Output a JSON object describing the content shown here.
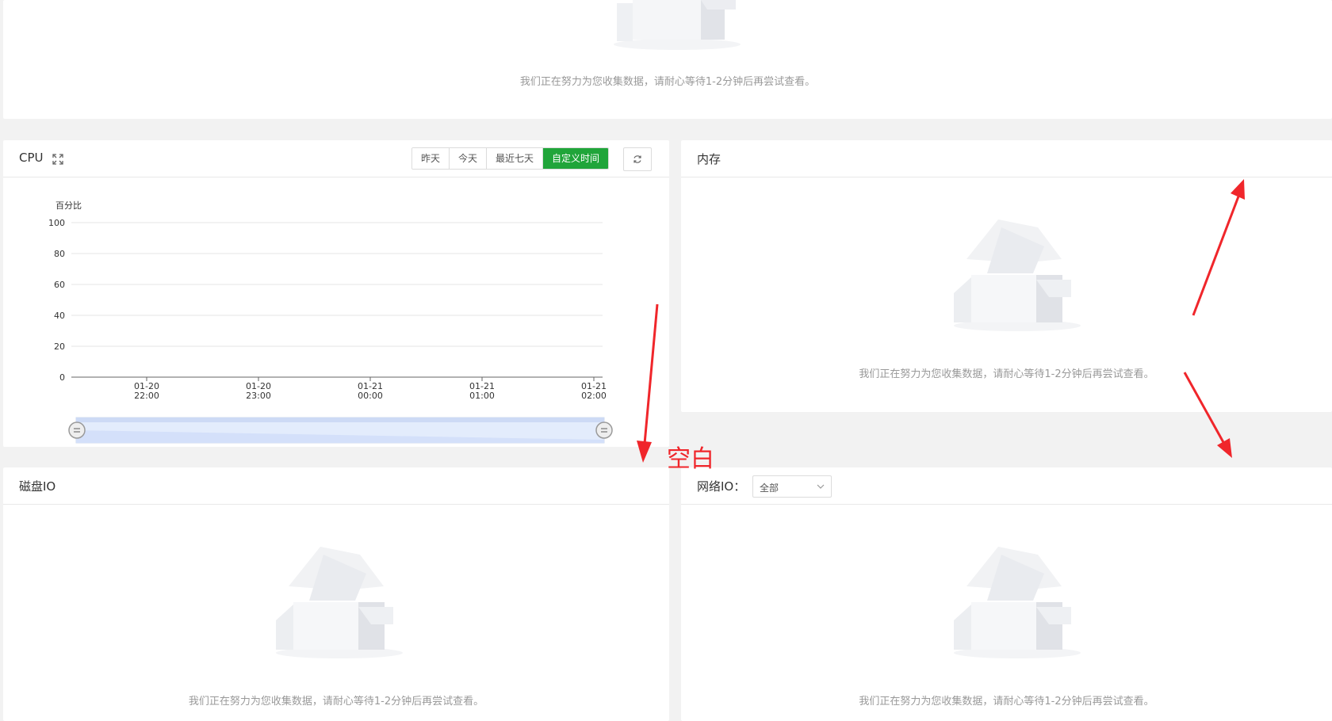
{
  "top_panel": {
    "empty_text": "我们正在努力为您收集数据，请耐心等待1-2分钟后再尝试查看。"
  },
  "cpu_panel": {
    "title": "CPU",
    "range_buttons": [
      "昨天",
      "今天",
      "最近七天",
      "自定义时间"
    ],
    "active_range": "自定义时间"
  },
  "memory_panel": {
    "title": "内存",
    "empty_text": "我们正在努力为您收集数据，请耐心等待1-2分钟后再尝试查看。"
  },
  "disk_panel": {
    "title": "磁盘IO",
    "empty_text": "我们正在努力为您收集数据，请耐心等待1-2分钟后再尝试查看。"
  },
  "network_panel": {
    "title": "网络IO：",
    "select_value": "全部",
    "empty_text": "我们正在努力为您收集数据，请耐心等待1-2分钟后再尝试查看。"
  },
  "annotation": {
    "label": "空白",
    "color": "#f0262b"
  },
  "colors": {
    "accent": "#20a53a",
    "zoom_fill": "#e3ecfc"
  },
  "chart_data": {
    "type": "line",
    "ylabel": "百分比",
    "ylim": [
      0,
      100
    ],
    "yticks": [
      "100",
      "80",
      "60",
      "40",
      "20",
      "0"
    ],
    "xticks": [
      {
        "date": "01-20",
        "time": "22:00"
      },
      {
        "date": "01-20",
        "time": "23:00"
      },
      {
        "date": "01-21",
        "time": "00:00"
      },
      {
        "date": "01-21",
        "time": "01:00"
      },
      {
        "date": "01-21",
        "time": "02:00"
      }
    ],
    "series": [],
    "grid": true
  }
}
